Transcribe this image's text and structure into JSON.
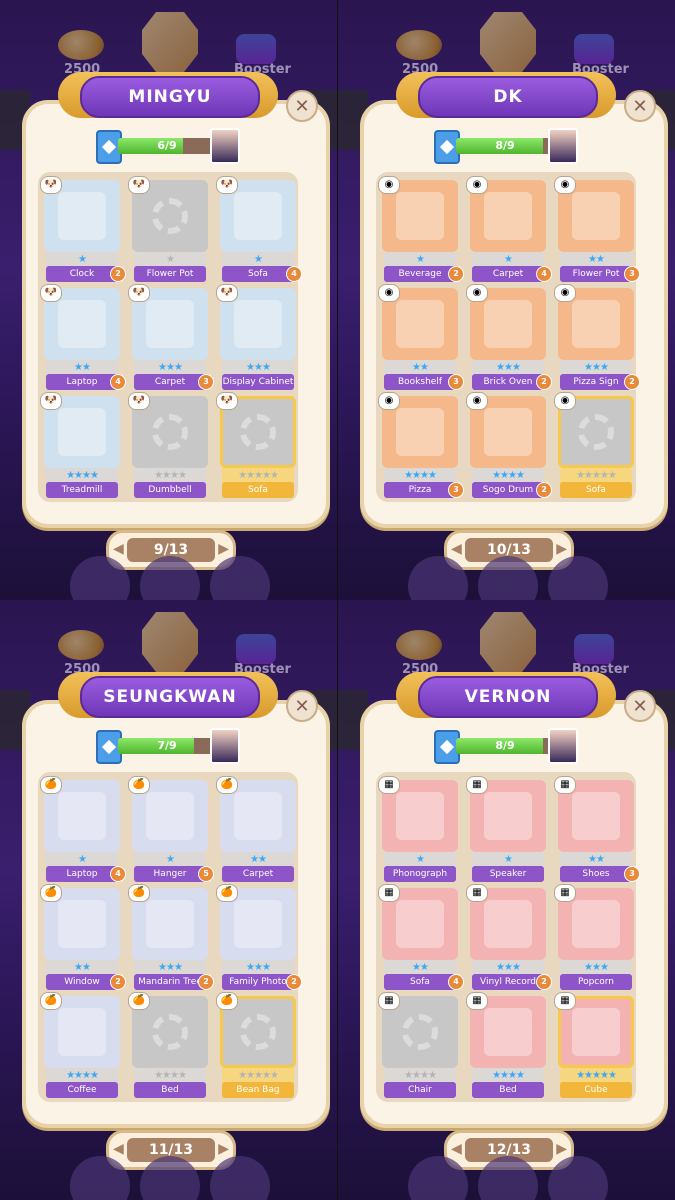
{
  "panels": [
    {
      "hud": {
        "coins": "2500",
        "booster": "Booster"
      },
      "title": "MINGYU",
      "close": "✕",
      "progress": {
        "text": "6/9",
        "fill": 0.667
      },
      "page": "9/13",
      "tag_icon": "dog-icon",
      "cards": [
        {
          "label": "Clock",
          "stars": "★",
          "badge": "2",
          "state": "unlocked",
          "color": "#cfe0ef"
        },
        {
          "label": "Flower Pot",
          "stars": "★",
          "badge": "",
          "state": "locked",
          "color": "#c7c7c7"
        },
        {
          "label": "Sofa",
          "stars": "★",
          "badge": "4",
          "state": "unlocked",
          "color": "#cfe0ef"
        },
        {
          "label": "Laptop",
          "stars": "★★",
          "badge": "4",
          "state": "unlocked",
          "color": "#cfe0ef"
        },
        {
          "label": "Carpet",
          "stars": "★★★",
          "badge": "3",
          "state": "unlocked",
          "color": "#cfe0ef"
        },
        {
          "label": "Display Cabinet",
          "stars": "★★★",
          "badge": "",
          "state": "unlocked",
          "color": "#cfe0ef"
        },
        {
          "label": "Treadmill",
          "stars": "★★★★",
          "badge": "",
          "state": "unlocked",
          "color": "#cfe0ef"
        },
        {
          "label": "Dumbbell",
          "stars": "★★★★",
          "badge": "",
          "state": "locked",
          "color": "#c7c7c7"
        },
        {
          "label": "Sofa",
          "stars": "★★★★★",
          "badge": "",
          "state": "locked-gold",
          "color": "#c7c7c7"
        }
      ]
    },
    {
      "hud": {
        "coins": "2500",
        "booster": "Booster"
      },
      "title": "DK",
      "close": "✕",
      "progress": {
        "text": "8/9",
        "fill": 0.889
      },
      "page": "10/13",
      "tag_icon": "record-icon",
      "cards": [
        {
          "label": "Beverage",
          "stars": "★",
          "badge": "2",
          "state": "unlocked",
          "color": "#f5b88a"
        },
        {
          "label": "Carpet",
          "stars": "★",
          "badge": "4",
          "state": "unlocked",
          "color": "#f5b88a"
        },
        {
          "label": "Flower Pot",
          "stars": "★★",
          "badge": "3",
          "state": "unlocked",
          "color": "#f5b88a"
        },
        {
          "label": "Bookshelf",
          "stars": "★★",
          "badge": "3",
          "state": "unlocked",
          "color": "#f5b88a"
        },
        {
          "label": "Brick Oven",
          "stars": "★★★",
          "badge": "2",
          "state": "unlocked",
          "color": "#f5b88a"
        },
        {
          "label": "Pizza Sign",
          "stars": "★★★",
          "badge": "2",
          "state": "unlocked",
          "color": "#f5b88a"
        },
        {
          "label": "Pizza",
          "stars": "★★★★",
          "badge": "3",
          "state": "unlocked",
          "color": "#f5b88a"
        },
        {
          "label": "Sogo Drum",
          "stars": "★★★★",
          "badge": "2",
          "state": "unlocked",
          "color": "#f5b88a"
        },
        {
          "label": "Sofa",
          "stars": "★★★★★",
          "badge": "",
          "state": "locked-gold",
          "color": "#c7c7c7"
        }
      ]
    },
    {
      "hud": {
        "coins": "2500",
        "booster": "Booster"
      },
      "title": "SEUNGKWAN",
      "close": "✕",
      "progress": {
        "text": "7/9",
        "fill": 0.778
      },
      "page": "11/13",
      "tag_icon": "tangerine-icon",
      "cards": [
        {
          "label": "Laptop",
          "stars": "★",
          "badge": "4",
          "state": "unlocked",
          "color": "#d8dcef"
        },
        {
          "label": "Hanger",
          "stars": "★",
          "badge": "5",
          "state": "unlocked",
          "color": "#d8dcef"
        },
        {
          "label": "Carpet",
          "stars": "★★",
          "badge": "",
          "state": "unlocked",
          "color": "#d8dcef"
        },
        {
          "label": "Window",
          "stars": "★★",
          "badge": "2",
          "state": "unlocked",
          "color": "#d8dcef"
        },
        {
          "label": "Mandarin Tree",
          "stars": "★★★",
          "badge": "2",
          "state": "unlocked",
          "color": "#d8dcef"
        },
        {
          "label": "Family Photo",
          "stars": "★★★",
          "badge": "2",
          "state": "unlocked",
          "color": "#d8dcef"
        },
        {
          "label": "Coffee",
          "stars": "★★★★",
          "badge": "",
          "state": "unlocked",
          "color": "#d8dcef"
        },
        {
          "label": "Bed",
          "stars": "★★★★",
          "badge": "",
          "state": "locked",
          "color": "#c7c7c7"
        },
        {
          "label": "Bean Bag",
          "stars": "★★★★★",
          "badge": "",
          "state": "locked-gold",
          "color": "#c7c7c7"
        }
      ]
    },
    {
      "hud": {
        "coins": "2500",
        "booster": "Booster"
      },
      "title": "VERNON",
      "close": "✕",
      "progress": {
        "text": "8/9",
        "fill": 0.889
      },
      "page": "12/13",
      "tag_icon": "card-icon",
      "cards": [
        {
          "label": "Phonograph",
          "stars": "★",
          "badge": "",
          "state": "unlocked",
          "color": "#f4b3b3"
        },
        {
          "label": "Speaker",
          "stars": "★",
          "badge": "",
          "state": "unlocked",
          "color": "#f4b3b3"
        },
        {
          "label": "Shoes",
          "stars": "★★",
          "badge": "3",
          "state": "unlocked",
          "color": "#f4b3b3"
        },
        {
          "label": "Sofa",
          "stars": "★★",
          "badge": "4",
          "state": "unlocked",
          "color": "#f4b3b3"
        },
        {
          "label": "Vinyl Record",
          "stars": "★★★",
          "badge": "2",
          "state": "unlocked",
          "color": "#f4b3b3"
        },
        {
          "label": "Popcorn",
          "stars": "★★★",
          "badge": "",
          "state": "unlocked",
          "color": "#f4b3b3"
        },
        {
          "label": "Chair",
          "stars": "★★★★",
          "badge": "",
          "state": "locked",
          "color": "#c7c7c7"
        },
        {
          "label": "Bed",
          "stars": "★★★★",
          "badge": "",
          "state": "unlocked",
          "color": "#f4b3b3"
        },
        {
          "label": "Cube",
          "stars": "★★★★★",
          "badge": "",
          "state": "unlocked-gold",
          "color": "#f4b3b3"
        }
      ]
    }
  ]
}
